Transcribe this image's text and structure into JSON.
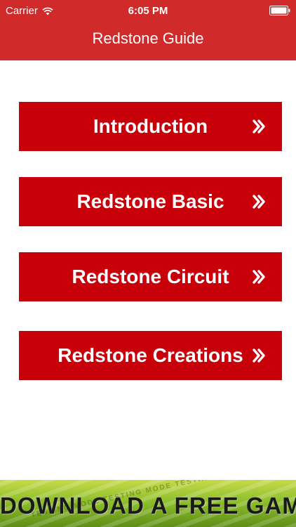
{
  "status_bar": {
    "carrier": "Carrier",
    "time": "6:05 PM"
  },
  "header": {
    "title": "Redstone Guide"
  },
  "menu": {
    "items": [
      {
        "label": "Introduction"
      },
      {
        "label": "Redstone Basic"
      },
      {
        "label": "Redstone Circuit"
      },
      {
        "label": "Redstone Creations"
      }
    ]
  },
  "ad": {
    "text": "DOWNLOAD A FREE GAME!",
    "watermark": "TESTING MODE TESTING MODE TESTING MODE TESTING MODE"
  },
  "colors": {
    "header_bg": "#d02a2a",
    "button_bg": "#c8000a",
    "ad_green": "#8fbf2c"
  },
  "icons": {
    "wifi": "wifi-icon",
    "battery": "battery-icon",
    "chevron": "double-chevron-right-icon"
  }
}
